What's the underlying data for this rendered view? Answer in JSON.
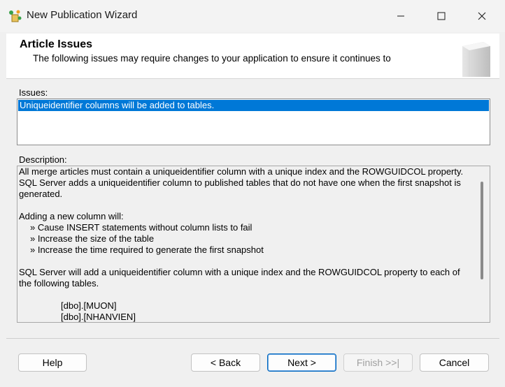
{
  "window": {
    "title": "New Publication Wizard",
    "icon": "wizard-app-icon"
  },
  "header": {
    "title": "Article Issues",
    "subtitle": "The following issues may require changes to your application to ensure it continues to"
  },
  "issues": {
    "label": "Issues:",
    "items": [
      "Uniqueidentifier columns will be added to tables."
    ]
  },
  "description": {
    "label": "Description:",
    "intro_line1": "All merge articles must contain a uniqueidentifier column with a unique index and the ROWGUIDCOL property.",
    "intro_line2": "SQL Server adds a uniqueidentifier column to published tables that do not have one when the first snapshot is",
    "intro_line3": "generated.",
    "adding_heading": "Adding a new column will:",
    "bullets": [
      "» Cause INSERT statements without column lists to fail",
      "» Increase the size of the table",
      "» Increase the time required to generate the first snapshot"
    ],
    "summary_line1": "SQL Server will add a uniqueidentifier column with a unique index and the ROWGUIDCOL property to each of",
    "summary_line2": "the following tables.",
    "tables": [
      "[dbo].[MUON]",
      "[dbo].[NHANVIEN]"
    ]
  },
  "buttons": {
    "help": "Help",
    "back": "< Back",
    "next": "Next >",
    "finish": "Finish >>|",
    "cancel": "Cancel"
  },
  "colors": {
    "selection": "#0078d7",
    "window_bg": "#f0f0f0"
  }
}
